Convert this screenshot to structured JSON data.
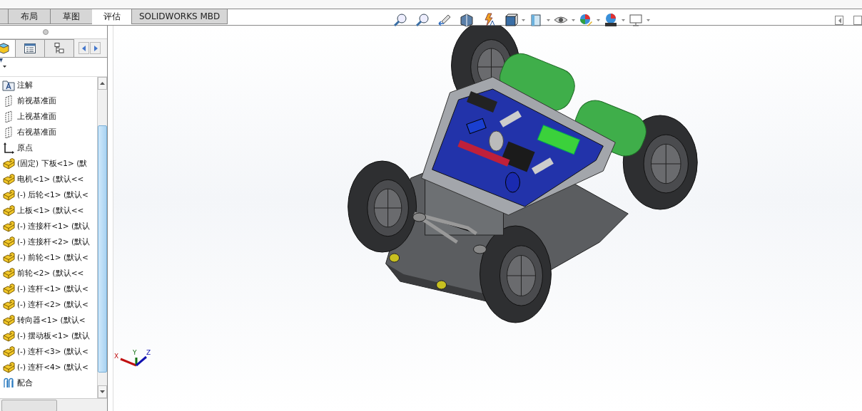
{
  "command_tabs": [
    {
      "label": "布局",
      "selected": false
    },
    {
      "label": "草图",
      "selected": false
    },
    {
      "label": "评估",
      "selected": true
    },
    {
      "label": "SOLIDWORKS MBD",
      "selected": false
    }
  ],
  "panel_tabs": [
    {
      "kind": "feature",
      "selected": true
    },
    {
      "kind": "property",
      "selected": false
    },
    {
      "kind": "config",
      "selected": false
    }
  ],
  "feature_tree": [
    {
      "kind": "annotation",
      "label": "注解"
    },
    {
      "kind": "plane",
      "label": "前视基准面"
    },
    {
      "kind": "plane",
      "label": "上视基准面"
    },
    {
      "kind": "plane",
      "label": "右视基准面"
    },
    {
      "kind": "origin",
      "label": "原点"
    },
    {
      "kind": "part",
      "label": "(固定) 下板<1> (默"
    },
    {
      "kind": "part",
      "label": "电机<1> (默认<<"
    },
    {
      "kind": "part",
      "label": "(-) 后轮<1> (默认<"
    },
    {
      "kind": "part",
      "label": "上板<1> (默认<<"
    },
    {
      "kind": "part",
      "label": "(-) 连接杆<1> (默认"
    },
    {
      "kind": "part",
      "label": "(-) 连接杆<2> (默认"
    },
    {
      "kind": "part",
      "label": "(-) 前轮<1> (默认<"
    },
    {
      "kind": "part",
      "label": "前轮<2> (默认<<"
    },
    {
      "kind": "part",
      "label": "(-) 连杆<1> (默认<"
    },
    {
      "kind": "part",
      "label": "(-) 连杆<2> (默认<"
    },
    {
      "kind": "part",
      "label": "转向器<1> (默认<"
    },
    {
      "kind": "part",
      "label": "(-) 摆动板<1> (默认"
    },
    {
      "kind": "part",
      "label": "(-) 连杆<3> (默认<"
    },
    {
      "kind": "part",
      "label": "(-) 连杆<4> (默认<"
    },
    {
      "kind": "mates",
      "label": "配合"
    }
  ],
  "view_toolbar": [
    {
      "kind": "zoom-fit",
      "dropdown": false
    },
    {
      "kind": "zoom-area",
      "dropdown": false
    },
    {
      "kind": "previous-view",
      "dropdown": false
    },
    {
      "kind": "section-view",
      "dropdown": false
    },
    {
      "kind": "dynamic-annotation",
      "dropdown": false
    },
    {
      "kind": "view-orientation",
      "dropdown": true
    },
    {
      "kind": "display-style",
      "dropdown": true
    },
    {
      "kind": "hide-show",
      "dropdown": true
    },
    {
      "kind": "edit-appearance",
      "dropdown": true
    },
    {
      "kind": "apply-scene",
      "dropdown": true
    },
    {
      "kind": "view-settings",
      "dropdown": true
    }
  ],
  "triad": {
    "x": "X",
    "y": "Y",
    "z": "Z"
  }
}
